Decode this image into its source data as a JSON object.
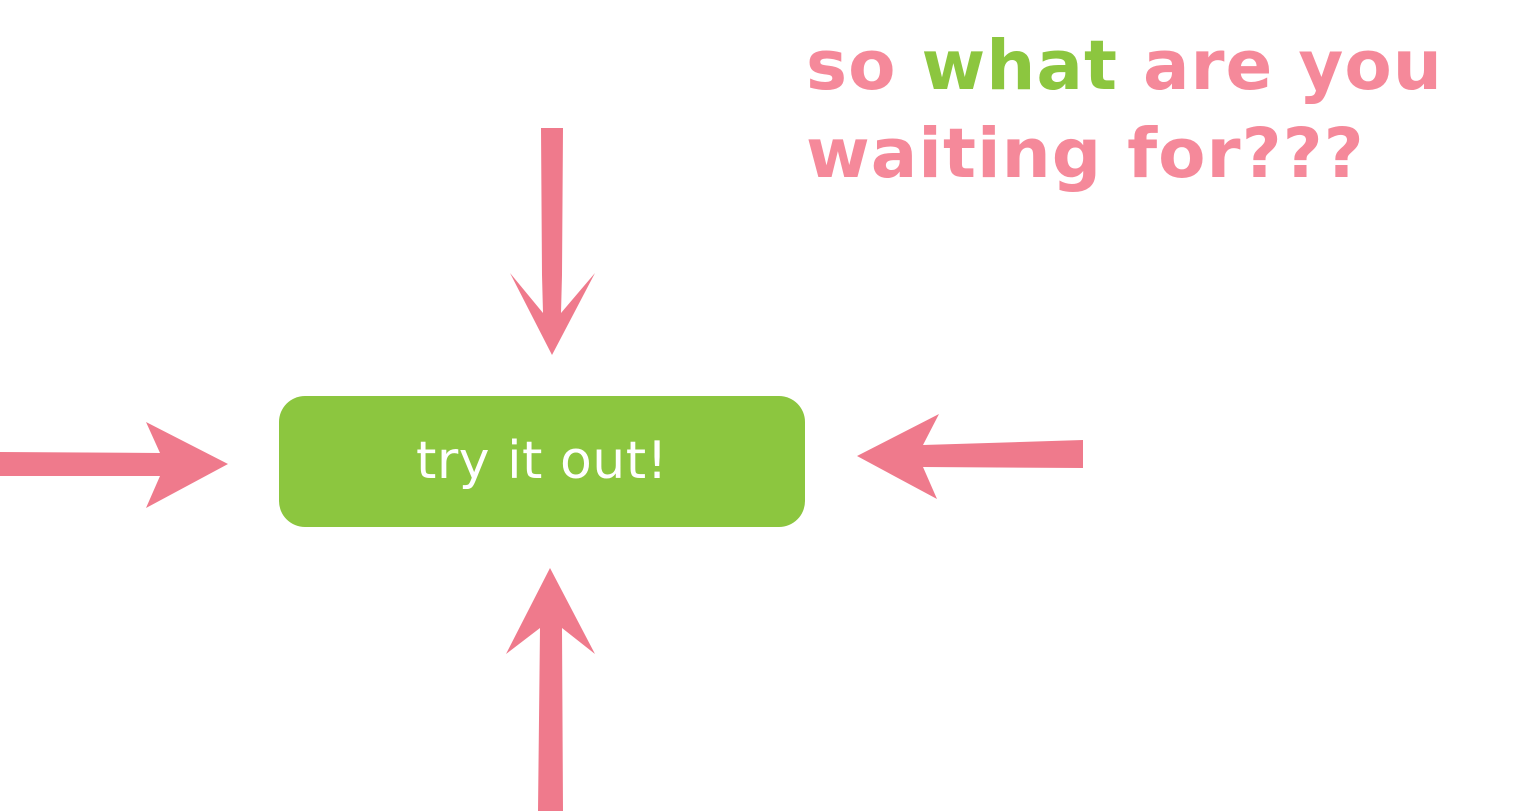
{
  "colors": {
    "pink": "#f5899a",
    "green": "#8cc63f",
    "arrow": "#ef7a8c",
    "button_text": "#ffffff"
  },
  "headline": {
    "word_so": "so",
    "word_what": "what",
    "word_are_you": "are you",
    "line2": "waiting for???"
  },
  "cta": {
    "label": "try it out!"
  },
  "arrows": [
    {
      "name": "arrow-down-icon",
      "direction": "down"
    },
    {
      "name": "arrow-right-icon",
      "direction": "right"
    },
    {
      "name": "arrow-left-icon",
      "direction": "left"
    },
    {
      "name": "arrow-up-icon",
      "direction": "up"
    }
  ]
}
